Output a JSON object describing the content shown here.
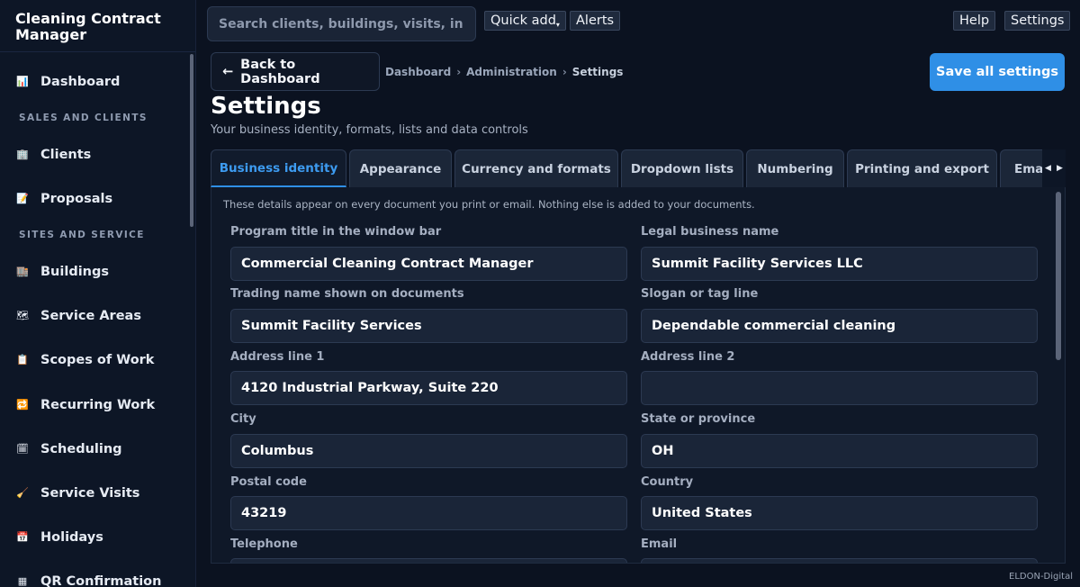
{
  "app": {
    "title": "Cleaning Contract Manager"
  },
  "sidebar": {
    "dashboard": {
      "label": "Dashboard",
      "icon": "chart-icon"
    },
    "section_sales": "SALES AND CLIENTS",
    "clients": {
      "label": "Clients",
      "icon": "office-building-icon"
    },
    "proposals": {
      "label": "Proposals",
      "icon": "memo-icon"
    },
    "section_sites": "SITES AND SERVICE",
    "buildings": {
      "label": "Buildings",
      "icon": "buildings-icon"
    },
    "service_areas": {
      "label": "Service Areas",
      "icon": "map-icon"
    },
    "scopes": {
      "label": "Scopes of Work",
      "icon": "clipboard-icon"
    },
    "recurring": {
      "label": "Recurring Work",
      "icon": "repeat-icon"
    },
    "scheduling": {
      "label": "Scheduling",
      "icon": "calendar-spiral-icon"
    },
    "visits": {
      "label": "Service Visits",
      "icon": "broom-icon"
    },
    "holidays": {
      "label": "Holidays",
      "icon": "calendar-icon"
    },
    "qr": {
      "label": "QR Confirmation",
      "icon": "qr-code-icon"
    }
  },
  "topbar": {
    "search_placeholder": "Search clients, buildings, visits, in...",
    "quick_add": "Quick add",
    "alerts": "Alerts",
    "help": "Help",
    "settings": "Settings"
  },
  "header": {
    "back": "Back to Dashboard",
    "crumb_1": "Dashboard",
    "crumb_2": "Administration",
    "crumb_3": "Settings",
    "save": "Save all settings",
    "title": "Settings",
    "subtitle": "Your business identity, formats, lists and data controls"
  },
  "tabs": {
    "business": "Business identity",
    "appearance": "Appearance",
    "currency": "Currency and formats",
    "dropdown": "Dropdown lists",
    "numbering": "Numbering",
    "printing": "Printing and export",
    "email": "Ema"
  },
  "form": {
    "note": "These details appear on every document you print or email. Nothing else is added to your documents.",
    "program_title": {
      "label": "Program title in the window bar",
      "value": "Commercial Cleaning Contract Manager"
    },
    "legal_name": {
      "label": "Legal business name",
      "value": "Summit Facility Services LLC"
    },
    "trading_name": {
      "label": "Trading name shown on documents",
      "value": "Summit Facility Services"
    },
    "slogan": {
      "label": "Slogan or tag line",
      "value": "Dependable commercial cleaning"
    },
    "address1": {
      "label": "Address line 1",
      "value": "4120 Industrial Parkway, Suite 220"
    },
    "address2": {
      "label": "Address line 2",
      "value": ""
    },
    "city": {
      "label": "City",
      "value": "Columbus"
    },
    "state": {
      "label": "State or province",
      "value": "OH"
    },
    "postal": {
      "label": "Postal code",
      "value": "43219"
    },
    "country": {
      "label": "Country",
      "value": "United States"
    },
    "telephone": {
      "label": "Telephone",
      "value": ""
    },
    "email": {
      "label": "Email",
      "value": ""
    }
  },
  "footer": {
    "brand": "ELDON-Digital"
  },
  "colors": {
    "accent": "#2f8fe6",
    "background": "#0b1220",
    "sidebar": "#0d1626"
  }
}
